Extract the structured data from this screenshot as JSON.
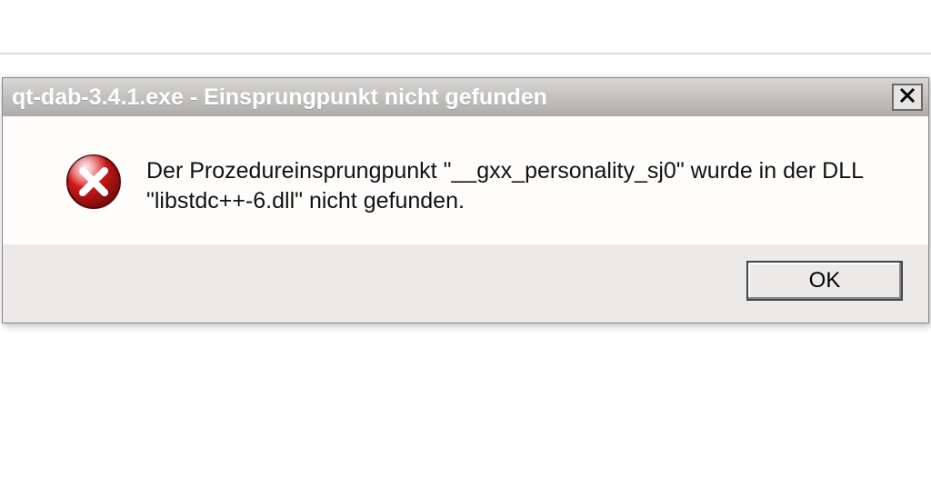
{
  "dialog": {
    "title": "qt-dab-3.4.1.exe - Einsprungpunkt nicht gefunden",
    "message": "Der Prozedureinsprungpunkt \"__gxx_personality_sj0\" wurde in der DLL \"libstdc++-6.dll\" nicht gefunden.",
    "ok_label": "OK",
    "icon": "error-icon"
  }
}
